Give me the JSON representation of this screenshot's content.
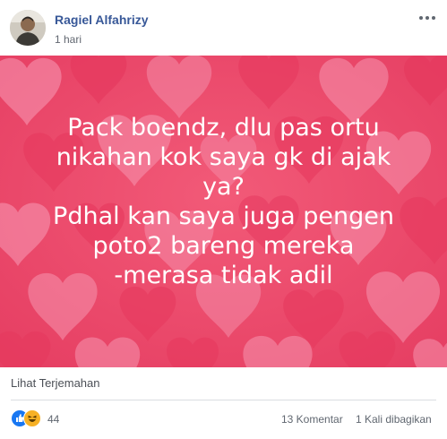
{
  "post": {
    "author_name": "Ragiel Alfahrizy",
    "timestamp": "1 hari",
    "status_lines": [
      "Pack boendz, dlu pas ortu",
      "nikahan kok saya gk di ajak",
      "ya?",
      "Pdhal kan saya juga pengen",
      "poto2 bareng mereka",
      "-merasa tidak adil"
    ],
    "background_theme": "pink-hearts",
    "translate_link": "Lihat Terjemahan"
  },
  "engagement": {
    "reaction_icons": [
      "like-icon",
      "haha-icon"
    ],
    "reaction_count": "44",
    "comments": "13 Komentar",
    "shares": "1 Kali dibagikan"
  },
  "colors": {
    "author_link": "#385898",
    "banner_base": "#ee4b6c",
    "heart_light": "#f79bb6",
    "heart_dark": "#e6395e",
    "like_blue": "#1877f2",
    "haha_yellow": "#f7b125"
  }
}
